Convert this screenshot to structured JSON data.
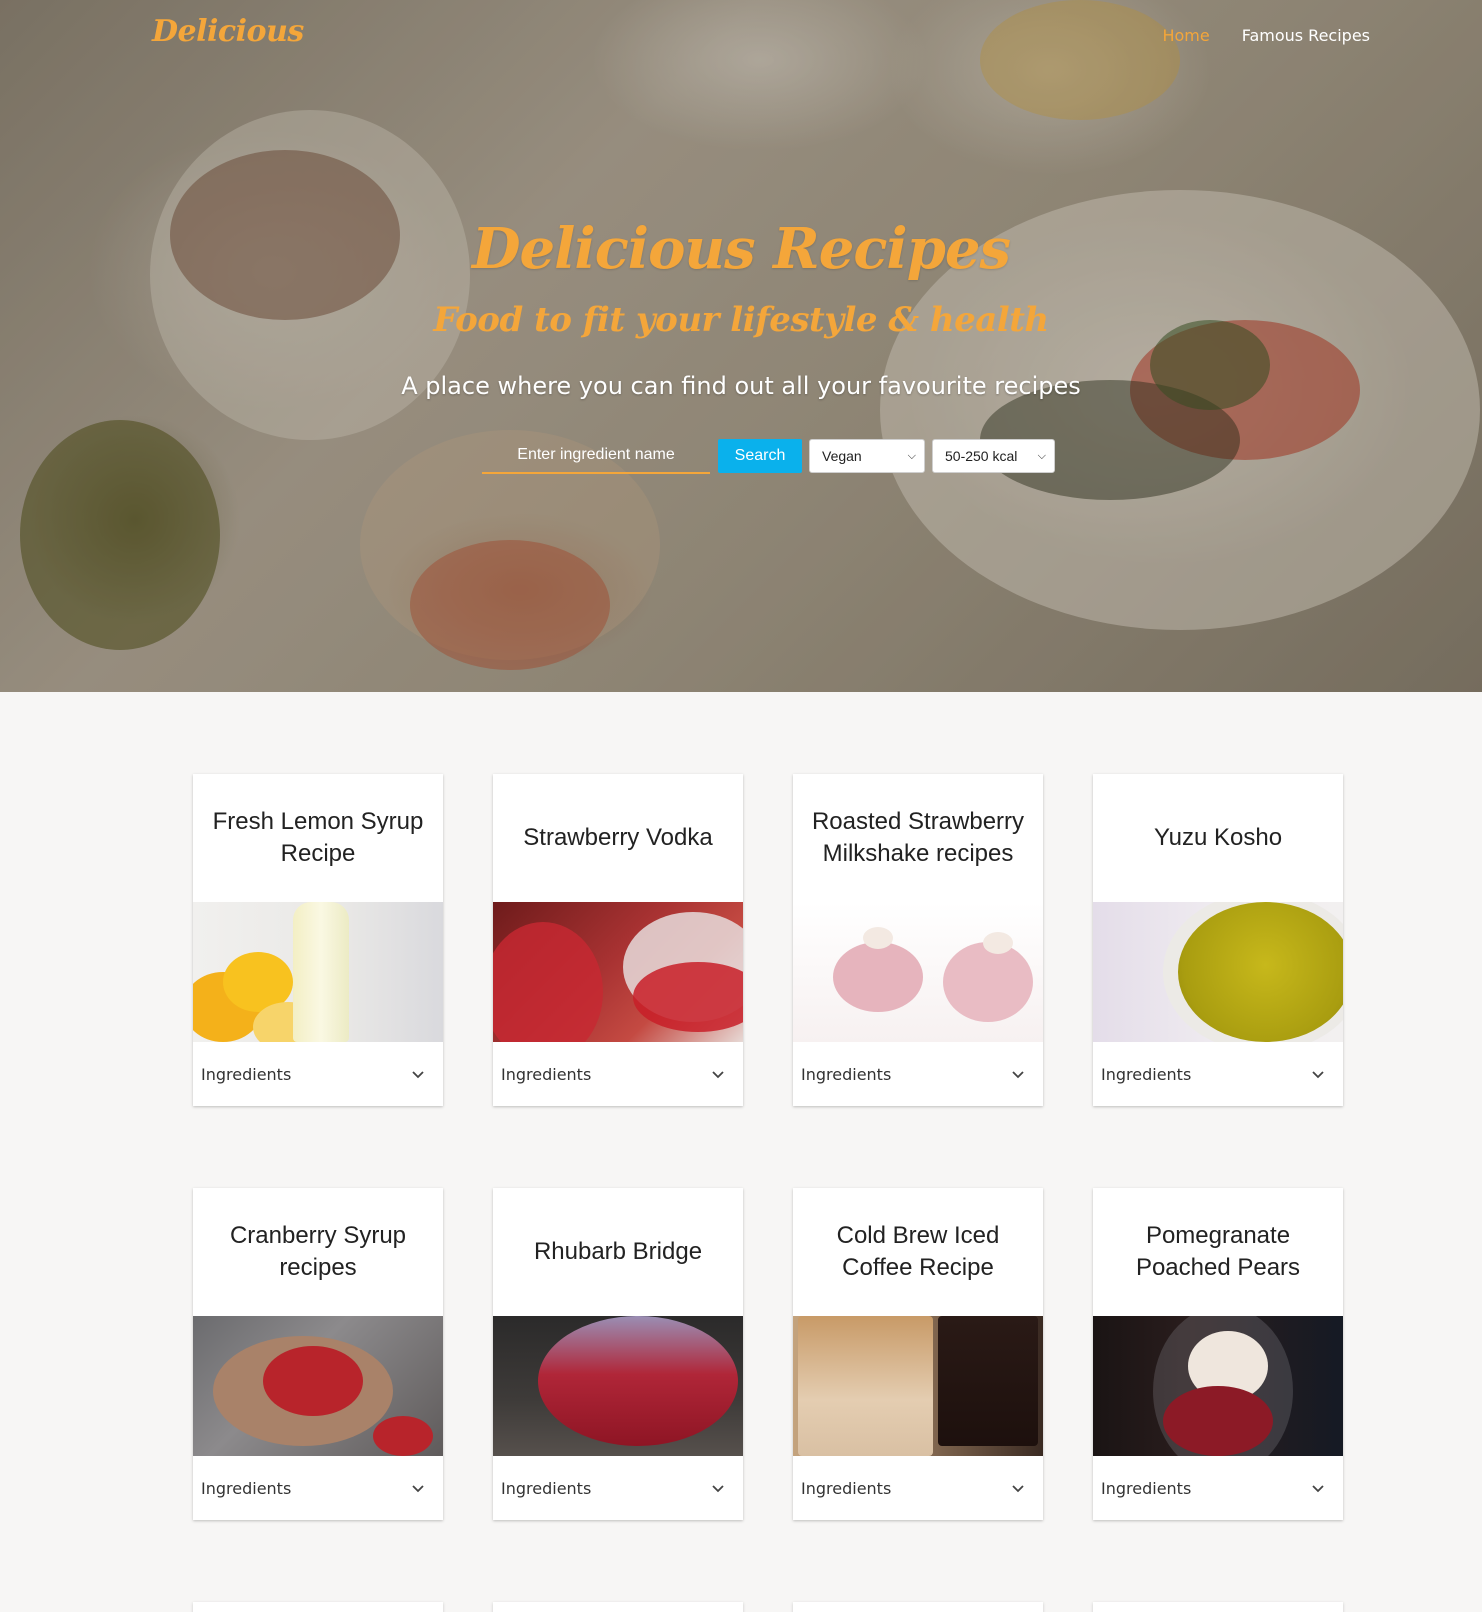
{
  "nav": {
    "logo": "Delicious",
    "links": [
      {
        "label": "Home",
        "active": true
      },
      {
        "label": "Famous Recipes",
        "active": false
      }
    ]
  },
  "hero": {
    "title": "Delicious Recipes",
    "subtitle": "Food to fit your lifestyle & health",
    "tagline": "A place where you can find out all your favourite recipes"
  },
  "search": {
    "placeholder": "Enter ingredient name",
    "button_label": "Search",
    "diet_selected": "Vegan",
    "calories_selected": "50-250 kcal"
  },
  "colors": {
    "accent": "#f4a63a",
    "search_button": "#0ab1ec"
  },
  "cards": [
    {
      "title": "Fresh Lemon Syrup Recipe",
      "footer": "Ingredients",
      "image_icon": "lemon-syrup-photo"
    },
    {
      "title": "Strawberry Vodka",
      "footer": "Ingredients",
      "image_icon": "red-drink-photo"
    },
    {
      "title": "Roasted Strawberry Milkshake recipes",
      "footer": "Ingredients",
      "image_icon": "milkshake-photo"
    },
    {
      "title": "Yuzu Kosho",
      "footer": "Ingredients",
      "image_icon": "yellow-sauce-photo"
    },
    {
      "title": "Cranberry Syrup recipes",
      "footer": "Ingredients",
      "image_icon": "cranberry-tart-photo"
    },
    {
      "title": "Rhubarb Bridge",
      "footer": "Ingredients",
      "image_icon": "cocktail-glass-photo"
    },
    {
      "title": "Cold Brew Iced Coffee Recipe",
      "footer": "Ingredients",
      "image_icon": "iced-coffee-photo"
    },
    {
      "title": "Pomegranate Poached Pears",
      "footer": "Ingredients",
      "image_icon": "dessert-glass-photo"
    }
  ]
}
